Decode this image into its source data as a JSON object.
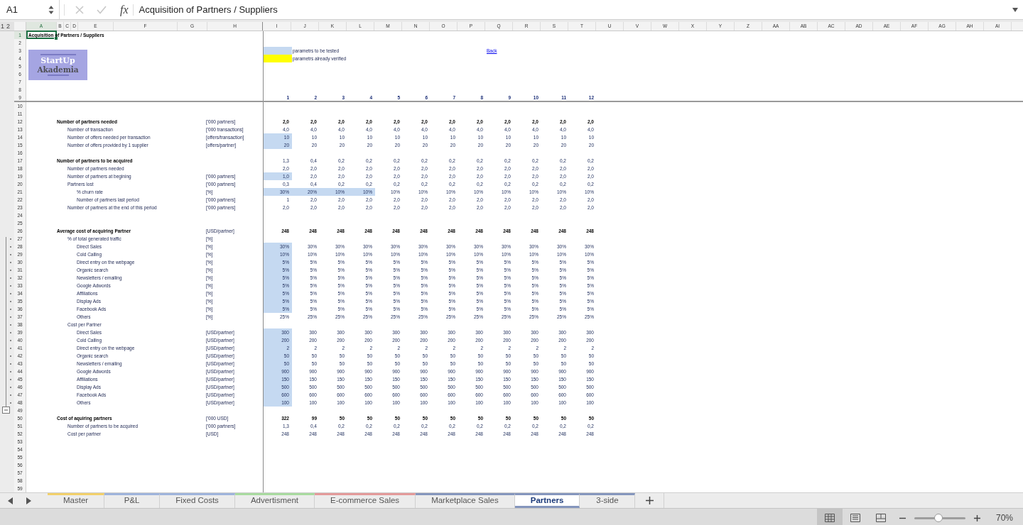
{
  "formula_bar": {
    "cell_name": "A1",
    "fx": "fx",
    "formula": "Acquisition of Partners / Suppliers"
  },
  "outline_levels": [
    "1",
    "2"
  ],
  "columns": [
    "A",
    "B",
    "C",
    "D",
    "E",
    "F",
    "G",
    "H",
    "I",
    "J",
    "K",
    "L",
    "M",
    "N",
    "O",
    "P",
    "Q",
    "R",
    "S",
    "T",
    "U",
    "V",
    "W",
    "X",
    "Y",
    "Z",
    "AA",
    "AB",
    "AC",
    "AD",
    "AE",
    "AF",
    "AG",
    "AH",
    "AI"
  ],
  "logo": {
    "line1": "StartUp",
    "line2": "Akademia"
  },
  "rows": [
    {
      "n": "1",
      "kind": "title",
      "label": "Acquisition of Partners / Suppliers",
      "selected": true,
      "grouped": false
    },
    {
      "n": "2",
      "kind": "blank",
      "selected": false,
      "grouped": false
    },
    {
      "n": "3",
      "kind": "legend",
      "color": "#c5d9f1",
      "text": "parametrs to be tested",
      "link": "Back",
      "selected": false,
      "grouped": false
    },
    {
      "n": "4",
      "kind": "legend",
      "color": "#ffff00",
      "text": "parametrs already verified",
      "selected": false,
      "grouped": false
    },
    {
      "n": "5",
      "kind": "blank",
      "selected": false,
      "grouped": false
    },
    {
      "n": "6",
      "kind": "blank",
      "selected": false,
      "grouped": false
    },
    {
      "n": "7",
      "kind": "blank",
      "selected": false,
      "grouped": false
    },
    {
      "n": "8",
      "kind": "blank",
      "selected": false,
      "grouped": false
    },
    {
      "n": "9",
      "kind": "index",
      "values": [
        "1",
        "2",
        "3",
        "4",
        "5",
        "6",
        "7",
        "8",
        "9",
        "10",
        "11",
        "12"
      ],
      "selected": false,
      "grouped": false
    },
    {
      "n": "10",
      "kind": "blank",
      "selected": false,
      "grouped": false
    },
    {
      "n": "11",
      "kind": "blank",
      "selected": false,
      "grouped": false
    },
    {
      "n": "12",
      "kind": "heading",
      "label": "Number of partners needed",
      "unit": "['000 partners]",
      "values_bold": true,
      "values": [
        "2,0",
        "2,0",
        "2,0",
        "2,0",
        "2,0",
        "2,0",
        "2,0",
        "2,0",
        "2,0",
        "2,0",
        "2,0",
        "2,0"
      ],
      "tested": [
        false,
        false,
        false,
        false,
        false,
        false,
        false,
        false,
        false,
        false,
        false,
        false
      ],
      "selected": false,
      "grouped": false
    },
    {
      "n": "13",
      "kind": "item",
      "label": "Number of transaction",
      "unit": "['000 transactions]",
      "values_bold": false,
      "values": [
        "4,0",
        "4,0",
        "4,0",
        "4,0",
        "4,0",
        "4,0",
        "4,0",
        "4,0",
        "4,0",
        "4,0",
        "4,0",
        "4,0"
      ],
      "tested": [
        false,
        false,
        false,
        false,
        false,
        false,
        false,
        false,
        false,
        false,
        false,
        false
      ],
      "selected": false,
      "grouped": false
    },
    {
      "n": "14",
      "kind": "item",
      "label": "Number of offers needed per transaction",
      "unit": "[offers/transaction]",
      "values_bold": false,
      "values": [
        "10",
        "10",
        "10",
        "10",
        "10",
        "10",
        "10",
        "10",
        "10",
        "10",
        "10",
        "10"
      ],
      "tested": [
        true,
        false,
        false,
        false,
        false,
        false,
        false,
        false,
        false,
        false,
        false,
        false
      ],
      "selected": false,
      "grouped": false
    },
    {
      "n": "15",
      "kind": "item",
      "label": "Number of offers provided by 1 supplier",
      "unit": "[offers/partner]",
      "values_bold": false,
      "values": [
        "20",
        "20",
        "20",
        "20",
        "20",
        "20",
        "20",
        "20",
        "20",
        "20",
        "20",
        "20"
      ],
      "tested": [
        true,
        false,
        false,
        false,
        false,
        false,
        false,
        false,
        false,
        false,
        false,
        false
      ],
      "selected": false,
      "grouped": false
    },
    {
      "n": "16",
      "kind": "blank",
      "selected": false,
      "grouped": false
    },
    {
      "n": "17",
      "kind": "heading",
      "label": "Number of partners to be acquired",
      "values_bold": false,
      "values": [
        "1,3",
        "0,4",
        "0,2",
        "0,2",
        "0,2",
        "0,2",
        "0,2",
        "0,2",
        "0,2",
        "0,2",
        "0,2",
        "0,2"
      ],
      "tested": [
        false,
        false,
        false,
        false,
        false,
        false,
        false,
        false,
        false,
        false,
        false,
        false
      ],
      "selected": false,
      "grouped": false
    },
    {
      "n": "18",
      "kind": "item",
      "label": "Number of partners needed",
      "values_bold": false,
      "values": [
        "2,0",
        "2,0",
        "2,0",
        "2,0",
        "2,0",
        "2,0",
        "2,0",
        "2,0",
        "2,0",
        "2,0",
        "2,0",
        "2,0"
      ],
      "tested": [
        false,
        false,
        false,
        false,
        false,
        false,
        false,
        false,
        false,
        false,
        false,
        false
      ],
      "selected": false,
      "grouped": false
    },
    {
      "n": "19",
      "kind": "item",
      "label": "Number of partners at begining",
      "unit": "['000 partners]",
      "values_bold": false,
      "values": [
        "1,0",
        "2,0",
        "2,0",
        "2,0",
        "2,0",
        "2,0",
        "2,0",
        "2,0",
        "2,0",
        "2,0",
        "2,0",
        "2,0"
      ],
      "tested": [
        true,
        false,
        false,
        false,
        false,
        false,
        false,
        false,
        false,
        false,
        false,
        false
      ],
      "selected": false,
      "grouped": false
    },
    {
      "n": "20",
      "kind": "item",
      "label": "Partners lost",
      "unit": "['000 partners]",
      "values_bold": false,
      "values": [
        "0,3",
        "0,4",
        "0,2",
        "0,2",
        "0,2",
        "0,2",
        "0,2",
        "0,2",
        "0,2",
        "0,2",
        "0,2",
        "0,2"
      ],
      "tested": [
        false,
        false,
        false,
        false,
        false,
        false,
        false,
        false,
        false,
        false,
        false,
        false
      ],
      "selected": false,
      "grouped": false
    },
    {
      "n": "21",
      "kind": "subitem",
      "label": "% churn rate",
      "unit": "[%]",
      "values_bold": false,
      "values": [
        "30%",
        "20%",
        "10%",
        "10%",
        "10%",
        "10%",
        "10%",
        "10%",
        "10%",
        "10%",
        "10%",
        "10%"
      ],
      "tested": [
        true,
        true,
        true,
        true,
        false,
        false,
        false,
        false,
        false,
        false,
        false,
        false
      ],
      "selected": false,
      "grouped": false
    },
    {
      "n": "22",
      "kind": "subitem",
      "label": "Number of partners last period",
      "unit": "['000 partners]",
      "values_bold": false,
      "values": [
        "1",
        "2,0",
        "2,0",
        "2,0",
        "2,0",
        "2,0",
        "2,0",
        "2,0",
        "2,0",
        "2,0",
        "2,0",
        "2,0"
      ],
      "tested": [
        false,
        false,
        false,
        false,
        false,
        false,
        false,
        false,
        false,
        false,
        false,
        false
      ],
      "selected": false,
      "grouped": false
    },
    {
      "n": "23",
      "kind": "item",
      "label": "Number of partners at the end of this period",
      "unit": "['000 partners]",
      "values_bold": false,
      "values": [
        "2,0",
        "2,0",
        "2,0",
        "2,0",
        "2,0",
        "2,0",
        "2,0",
        "2,0",
        "2,0",
        "2,0",
        "2,0",
        "2,0"
      ],
      "tested": [
        false,
        false,
        false,
        false,
        false,
        false,
        false,
        false,
        false,
        false,
        false,
        false
      ],
      "selected": false,
      "grouped": false
    },
    {
      "n": "24",
      "kind": "blank",
      "selected": false,
      "grouped": false
    },
    {
      "n": "25",
      "kind": "blank",
      "selected": false,
      "grouped": false
    },
    {
      "n": "26",
      "kind": "heading",
      "label": "Average cost of acquiring Partner",
      "unit": "[USD/partner]",
      "values_bold": true,
      "values": [
        "248",
        "248",
        "248",
        "248",
        "248",
        "248",
        "248",
        "248",
        "248",
        "248",
        "248",
        "248"
      ],
      "tested": [
        false,
        false,
        false,
        false,
        false,
        false,
        false,
        false,
        false,
        false,
        false,
        false
      ],
      "selected": false,
      "grouped": false
    },
    {
      "n": "27",
      "kind": "item",
      "label": "% of total generated traffic",
      "unit": "[%]",
      "selected": false,
      "grouped": true
    },
    {
      "n": "28",
      "kind": "subitem",
      "label": "Direct Sales",
      "unit": "[%]",
      "values_bold": false,
      "values": [
        "30%",
        "30%",
        "30%",
        "30%",
        "30%",
        "30%",
        "30%",
        "30%",
        "30%",
        "30%",
        "30%",
        "30%"
      ],
      "tested": [
        true,
        false,
        false,
        false,
        false,
        false,
        false,
        false,
        false,
        false,
        false,
        false
      ],
      "selected": false,
      "grouped": true
    },
    {
      "n": "29",
      "kind": "subitem",
      "label": "Cold Calling",
      "unit": "[%]",
      "values_bold": false,
      "values": [
        "10%",
        "10%",
        "10%",
        "10%",
        "10%",
        "10%",
        "10%",
        "10%",
        "10%",
        "10%",
        "10%",
        "10%"
      ],
      "tested": [
        true,
        false,
        false,
        false,
        false,
        false,
        false,
        false,
        false,
        false,
        false,
        false
      ],
      "selected": false,
      "grouped": true
    },
    {
      "n": "30",
      "kind": "subitem",
      "label": "Direct entry on the webpage",
      "unit": "[%]",
      "values_bold": false,
      "values": [
        "5%",
        "5%",
        "5%",
        "5%",
        "5%",
        "5%",
        "5%",
        "5%",
        "5%",
        "5%",
        "5%",
        "5%"
      ],
      "tested": [
        true,
        false,
        false,
        false,
        false,
        false,
        false,
        false,
        false,
        false,
        false,
        false
      ],
      "selected": false,
      "grouped": true
    },
    {
      "n": "31",
      "kind": "subitem",
      "label": "Organic search",
      "unit": "[%]",
      "values_bold": false,
      "values": [
        "5%",
        "5%",
        "5%",
        "5%",
        "5%",
        "5%",
        "5%",
        "5%",
        "5%",
        "5%",
        "5%",
        "5%"
      ],
      "tested": [
        true,
        false,
        false,
        false,
        false,
        false,
        false,
        false,
        false,
        false,
        false,
        false
      ],
      "selected": false,
      "grouped": true
    },
    {
      "n": "32",
      "kind": "subitem",
      "label": "Newsletters / emailing",
      "unit": "[%]",
      "values_bold": false,
      "values": [
        "5%",
        "5%",
        "5%",
        "5%",
        "5%",
        "5%",
        "5%",
        "5%",
        "5%",
        "5%",
        "5%",
        "5%"
      ],
      "tested": [
        true,
        false,
        false,
        false,
        false,
        false,
        false,
        false,
        false,
        false,
        false,
        false
      ],
      "selected": false,
      "grouped": true
    },
    {
      "n": "33",
      "kind": "subitem",
      "label": "Google Adwords",
      "unit": "[%]",
      "values_bold": false,
      "values": [
        "5%",
        "5%",
        "5%",
        "5%",
        "5%",
        "5%",
        "5%",
        "5%",
        "5%",
        "5%",
        "5%",
        "5%"
      ],
      "tested": [
        true,
        false,
        false,
        false,
        false,
        false,
        false,
        false,
        false,
        false,
        false,
        false
      ],
      "selected": false,
      "grouped": true
    },
    {
      "n": "34",
      "kind": "subitem",
      "label": "Affiliations",
      "unit": "[%]",
      "values_bold": false,
      "values": [
        "5%",
        "5%",
        "5%",
        "5%",
        "5%",
        "5%",
        "5%",
        "5%",
        "5%",
        "5%",
        "5%",
        "5%"
      ],
      "tested": [
        true,
        false,
        false,
        false,
        false,
        false,
        false,
        false,
        false,
        false,
        false,
        false
      ],
      "selected": false,
      "grouped": true
    },
    {
      "n": "35",
      "kind": "subitem",
      "label": "Display Ads",
      "unit": "[%]",
      "values_bold": false,
      "values": [
        "5%",
        "5%",
        "5%",
        "5%",
        "5%",
        "5%",
        "5%",
        "5%",
        "5%",
        "5%",
        "5%",
        "5%"
      ],
      "tested": [
        true,
        false,
        false,
        false,
        false,
        false,
        false,
        false,
        false,
        false,
        false,
        false
      ],
      "selected": false,
      "grouped": true
    },
    {
      "n": "36",
      "kind": "subitem",
      "label": "Facebook Ads",
      "unit": "[%]",
      "values_bold": false,
      "values": [
        "5%",
        "5%",
        "5%",
        "5%",
        "5%",
        "5%",
        "5%",
        "5%",
        "5%",
        "5%",
        "5%",
        "5%"
      ],
      "tested": [
        true,
        false,
        false,
        false,
        false,
        false,
        false,
        false,
        false,
        false,
        false,
        false
      ],
      "selected": false,
      "grouped": true
    },
    {
      "n": "37",
      "kind": "subitem",
      "label": "Others",
      "unit": "[%]",
      "values_bold": false,
      "values": [
        "25%",
        "25%",
        "25%",
        "25%",
        "25%",
        "25%",
        "25%",
        "25%",
        "25%",
        "25%",
        "25%",
        "25%"
      ],
      "tested": [
        false,
        false,
        false,
        false,
        false,
        false,
        false,
        false,
        false,
        false,
        false,
        false
      ],
      "selected": false,
      "grouped": true
    },
    {
      "n": "38",
      "kind": "item",
      "label": "Cost per Partner",
      "selected": false,
      "grouped": true
    },
    {
      "n": "39",
      "kind": "subitem",
      "label": "Direct Sales",
      "unit": "[USD/partner]",
      "values_bold": false,
      "values": [
        "300",
        "300",
        "300",
        "300",
        "300",
        "300",
        "300",
        "300",
        "300",
        "300",
        "300",
        "300"
      ],
      "tested": [
        true,
        false,
        false,
        false,
        false,
        false,
        false,
        false,
        false,
        false,
        false,
        false
      ],
      "selected": false,
      "grouped": true
    },
    {
      "n": "40",
      "kind": "subitem",
      "label": "Cold Calling",
      "unit": "[USD/partner]",
      "values_bold": false,
      "values": [
        "200",
        "200",
        "200",
        "200",
        "200",
        "200",
        "200",
        "200",
        "200",
        "200",
        "200",
        "200"
      ],
      "tested": [
        true,
        false,
        false,
        false,
        false,
        false,
        false,
        false,
        false,
        false,
        false,
        false
      ],
      "selected": false,
      "grouped": true
    },
    {
      "n": "41",
      "kind": "subitem",
      "label": "Direct entry on the webpage",
      "unit": "[USD/partner]",
      "values_bold": false,
      "values": [
        "2",
        "2",
        "2",
        "2",
        "2",
        "2",
        "2",
        "2",
        "2",
        "2",
        "2",
        "2"
      ],
      "tested": [
        true,
        false,
        false,
        false,
        false,
        false,
        false,
        false,
        false,
        false,
        false,
        false
      ],
      "selected": false,
      "grouped": true
    },
    {
      "n": "42",
      "kind": "subitem",
      "label": "Organic search",
      "unit": "[USD/partner]",
      "values_bold": false,
      "values": [
        "50",
        "50",
        "50",
        "50",
        "50",
        "50",
        "50",
        "50",
        "50",
        "50",
        "50",
        "50"
      ],
      "tested": [
        true,
        false,
        false,
        false,
        false,
        false,
        false,
        false,
        false,
        false,
        false,
        false
      ],
      "selected": false,
      "grouped": true
    },
    {
      "n": "43",
      "kind": "subitem",
      "label": "Newsletters / emailing",
      "unit": "[USD/partner]",
      "values_bold": false,
      "values": [
        "50",
        "50",
        "50",
        "50",
        "50",
        "50",
        "50",
        "50",
        "50",
        "50",
        "50",
        "50"
      ],
      "tested": [
        true,
        false,
        false,
        false,
        false,
        false,
        false,
        false,
        false,
        false,
        false,
        false
      ],
      "selected": false,
      "grouped": true
    },
    {
      "n": "44",
      "kind": "subitem",
      "label": "Google Adwords",
      "unit": "[USD/partner]",
      "values_bold": false,
      "values": [
        "900",
        "900",
        "900",
        "900",
        "900",
        "900",
        "900",
        "900",
        "900",
        "900",
        "900",
        "900"
      ],
      "tested": [
        true,
        false,
        false,
        false,
        false,
        false,
        false,
        false,
        false,
        false,
        false,
        false
      ],
      "selected": false,
      "grouped": true
    },
    {
      "n": "45",
      "kind": "subitem",
      "label": "Affiliations",
      "unit": "[USD/partner]",
      "values_bold": false,
      "values": [
        "150",
        "150",
        "150",
        "150",
        "150",
        "150",
        "150",
        "150",
        "150",
        "150",
        "150",
        "150"
      ],
      "tested": [
        true,
        false,
        false,
        false,
        false,
        false,
        false,
        false,
        false,
        false,
        false,
        false
      ],
      "selected": false,
      "grouped": true
    },
    {
      "n": "46",
      "kind": "subitem",
      "label": "Display Ads",
      "unit": "[USD/partner]",
      "values_bold": false,
      "values": [
        "500",
        "500",
        "500",
        "500",
        "500",
        "500",
        "500",
        "500",
        "500",
        "500",
        "500",
        "500"
      ],
      "tested": [
        true,
        false,
        false,
        false,
        false,
        false,
        false,
        false,
        false,
        false,
        false,
        false
      ],
      "selected": false,
      "grouped": true
    },
    {
      "n": "47",
      "kind": "subitem",
      "label": "Facebook Ads",
      "unit": "[USD/partner]",
      "values_bold": false,
      "values": [
        "600",
        "600",
        "600",
        "600",
        "600",
        "600",
        "600",
        "600",
        "600",
        "600",
        "600",
        "600"
      ],
      "tested": [
        true,
        false,
        false,
        false,
        false,
        false,
        false,
        false,
        false,
        false,
        false,
        false
      ],
      "selected": false,
      "grouped": true
    },
    {
      "n": "48",
      "kind": "subitem",
      "label": "Others",
      "unit": "[USD/partner]",
      "values_bold": false,
      "values": [
        "100",
        "100",
        "100",
        "100",
        "100",
        "100",
        "100",
        "100",
        "100",
        "100",
        "100",
        "100"
      ],
      "tested": [
        true,
        false,
        false,
        false,
        false,
        false,
        false,
        false,
        false,
        false,
        false,
        false
      ],
      "selected": false,
      "grouped": true
    },
    {
      "n": "49",
      "kind": "blank",
      "selected": false,
      "grouped": false
    },
    {
      "n": "50",
      "kind": "heading",
      "label": "Cost of aquiring partners",
      "unit": "['000 USD]",
      "values_bold": true,
      "values": [
        "322",
        "99",
        "50",
        "50",
        "50",
        "50",
        "50",
        "50",
        "50",
        "50",
        "50",
        "50"
      ],
      "tested": [
        false,
        false,
        false,
        false,
        false,
        false,
        false,
        false,
        false,
        false,
        false,
        false
      ],
      "selected": false,
      "grouped": false
    },
    {
      "n": "51",
      "kind": "item",
      "label": "Number of partners to be acquired",
      "unit": "['000 partners]",
      "values_bold": false,
      "values": [
        "1,3",
        "0,4",
        "0,2",
        "0,2",
        "0,2",
        "0,2",
        "0,2",
        "0,2",
        "0,2",
        "0,2",
        "0,2",
        "0,2"
      ],
      "tested": [
        false,
        false,
        false,
        false,
        false,
        false,
        false,
        false,
        false,
        false,
        false,
        false
      ],
      "selected": false,
      "grouped": false
    },
    {
      "n": "52",
      "kind": "item",
      "label": "Cost per partner",
      "unit": "[USD]",
      "values_bold": false,
      "values": [
        "248",
        "248",
        "248",
        "248",
        "248",
        "248",
        "248",
        "248",
        "248",
        "248",
        "248",
        "248"
      ],
      "tested": [
        false,
        false,
        false,
        false,
        false,
        false,
        false,
        false,
        false,
        false,
        false,
        false
      ],
      "selected": false,
      "grouped": false
    },
    {
      "n": "53",
      "kind": "blank",
      "selected": false,
      "grouped": false
    },
    {
      "n": "54",
      "kind": "blank",
      "selected": false,
      "grouped": false
    },
    {
      "n": "55",
      "kind": "blank",
      "selected": false,
      "grouped": false
    },
    {
      "n": "56",
      "kind": "blank",
      "selected": false,
      "grouped": false
    },
    {
      "n": "57",
      "kind": "blank",
      "selected": false,
      "grouped": false
    },
    {
      "n": "58",
      "kind": "blank",
      "selected": false,
      "grouped": false
    },
    {
      "n": "59",
      "kind": "blank",
      "selected": false,
      "grouped": false
    }
  ],
  "sheet_tabs": [
    {
      "label": "Master",
      "color": "#f2d06b",
      "selected": false
    },
    {
      "label": "P&L",
      "color": "#9fb4dc",
      "selected": false
    },
    {
      "label": "Fixed Costs",
      "color": "#9fb4dc",
      "selected": false
    },
    {
      "label": "Advertisment",
      "color": "#a9dba0",
      "selected": false
    },
    {
      "label": "E-commerce Sales",
      "color": "#e39a9a",
      "selected": false
    },
    {
      "label": "Marketplace Sales",
      "color": "#8596bd",
      "selected": false
    },
    {
      "label": "Partners",
      "color": "#8596bd",
      "selected": true
    },
    {
      "label": "3-side",
      "color": "#8596bd",
      "selected": false
    }
  ],
  "status_bar": {
    "view_buttons": [
      {
        "kind": "normal",
        "selected": true
      },
      {
        "kind": "page-layout",
        "selected": false
      },
      {
        "kind": "page-break",
        "selected": false
      }
    ],
    "zoom": {
      "level": 0.47,
      "reading": "70%"
    }
  }
}
